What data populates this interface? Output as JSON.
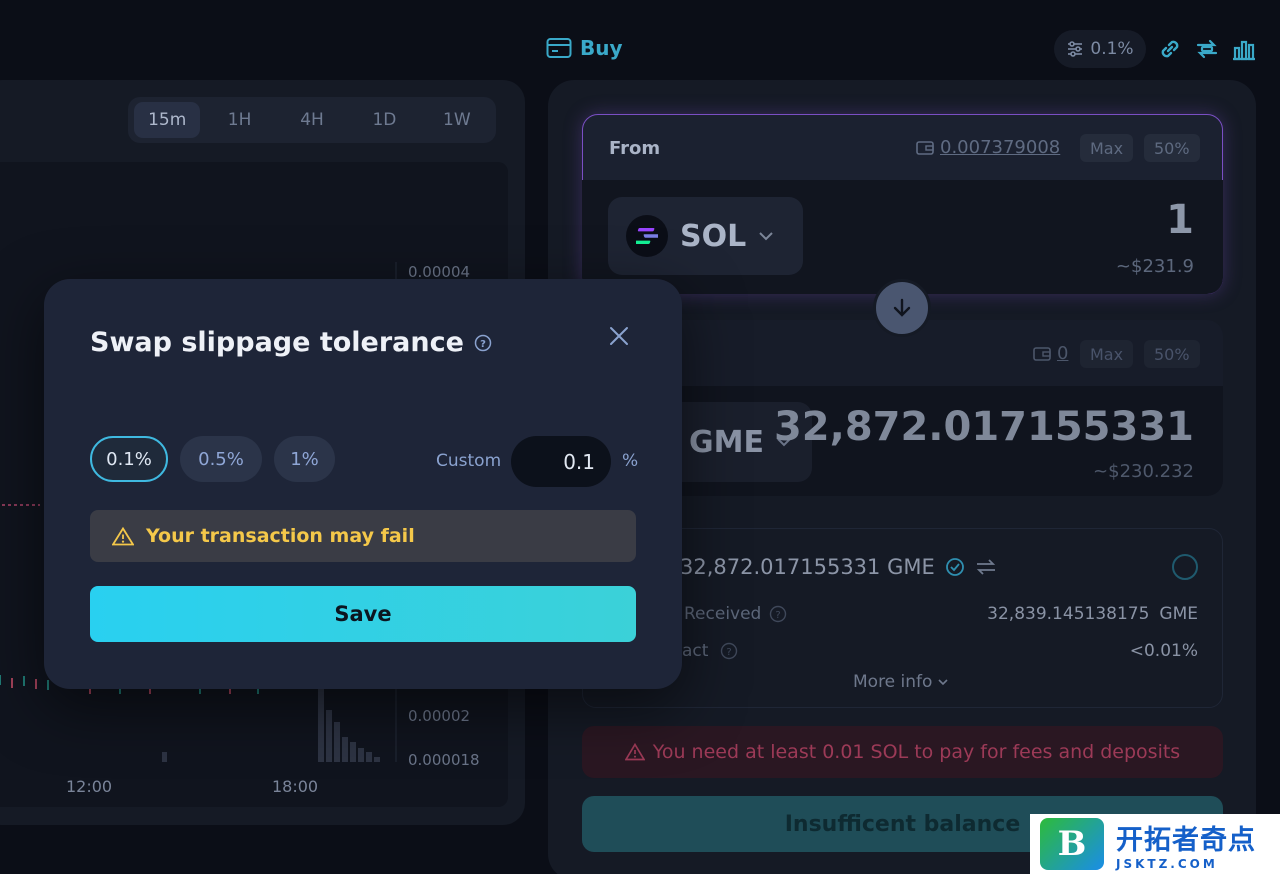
{
  "topbar": {
    "buy_label": "Buy",
    "slippage": "0.1%"
  },
  "chart": {
    "timeframes": [
      "15m",
      "1H",
      "4H",
      "1D",
      "1W"
    ],
    "active_timeframe": "15m",
    "y_labels": [
      "0.00004",
      "0.00002",
      "0.000018"
    ],
    "x_labels": [
      "12:00",
      "18:00"
    ]
  },
  "swap": {
    "from": {
      "label": "From",
      "balance": "0.007379008",
      "max": "Max",
      "half": "50%",
      "token": "SOL",
      "amount": "1",
      "usd": "~$231.9"
    },
    "to": {
      "balance": "0",
      "max": "Max",
      "half": "50%",
      "token": "GME",
      "amount": "32,872.017155331",
      "usd": "~$230.232"
    },
    "rate": "32,872.017155331 GME",
    "min_received_label": "Received",
    "min_received_value": "32,839.145138175",
    "min_received_unit": "GME",
    "impact_label": "act",
    "impact_value": "<0.01%",
    "more_info": "More info",
    "fee_warning": "You need at least 0.01 SOL to pay for fees and deposits",
    "submit_label": "Insufficent balance"
  },
  "modal": {
    "title": "Swap slippage tolerance",
    "options": [
      "0.1%",
      "0.5%",
      "1%"
    ],
    "custom_label": "Custom",
    "custom_value": "0.1",
    "percent_sign": "%",
    "warning": "Your transaction may fail",
    "save_label": "Save"
  },
  "watermark": {
    "logo_letter": "B",
    "title": "开拓者奇点",
    "sub": "JSKTZ.COM"
  },
  "colors": {
    "accent": "#3aa9c9",
    "purple_border": "#7a4fc4",
    "warning": "#f4c84a",
    "save_gradient_start": "#29d0f0"
  }
}
